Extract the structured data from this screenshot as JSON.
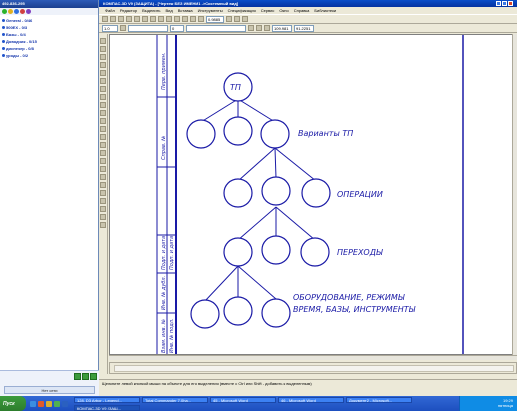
{
  "left_panel": {
    "title": "492-836-295",
    "groups": [
      "General - 0/46",
      "500ЕХ - 0/3",
      "Базы - 0/4",
      "Доводчик - 0/15",
      "диспечер - 0/8",
      "уроды - 0/2"
    ],
    "status": "Нет сети"
  },
  "window": {
    "title": "КОМПАС-3D V9 (ЗАЩИТА) - [Чертеж БЕЗ ИМЕНИ1 ->Системный вид]",
    "menu": [
      "Файл",
      "Редактор",
      "Выделить",
      "Вид",
      "Вставка",
      "Инструменты",
      "Спецификация",
      "Сервис",
      "Окно",
      "Справка",
      "Библиотеки"
    ],
    "toolbar": {
      "scale": "1.0",
      "zoom": "0.9885",
      "layer": "0",
      "coord_x": "109.981",
      "coord_y": "91.2251"
    },
    "status_text": "Щелкните левой кнопкой мыши на объекте для его выделения (вместе с Ctrl или Shift - добавить к выделенным)"
  },
  "drawing": {
    "frame_labels": [
      "Перв. примен.",
      "Справ. №",
      "Подп. и дата",
      "Инв. № дубл.",
      "Взам. инв. №",
      "Подп. и дата",
      "Инв. № подл."
    ],
    "root": "ТП",
    "level_labels": [
      "Варианты ТП",
      "ОПЕРАЦИИ",
      "ПЕРЕХОДЫ",
      "ОБОРУДОВАНИЕ, РЕЖИМЫ",
      "ВРЕМЯ, БАЗЫ, ИНСТРУМЕНТЫ"
    ]
  },
  "taskbar": {
    "start": "Пуск",
    "tasks": [
      "128. D3 Arbor - Legend...",
      "Total Commander 7.0ha...",
      "45 - Microsoft Word",
      "46 - Microsoft Word",
      "Документ2 - Microsoft...",
      "КОМПАС-3D V9 (ЗАЩ..."
    ],
    "time": "19:29",
    "day": "пятница"
  },
  "colors": {
    "drawing_line": "#1a1aa6",
    "title_bar": "#0a4ec9",
    "taskbar": "#2a5fcc"
  }
}
